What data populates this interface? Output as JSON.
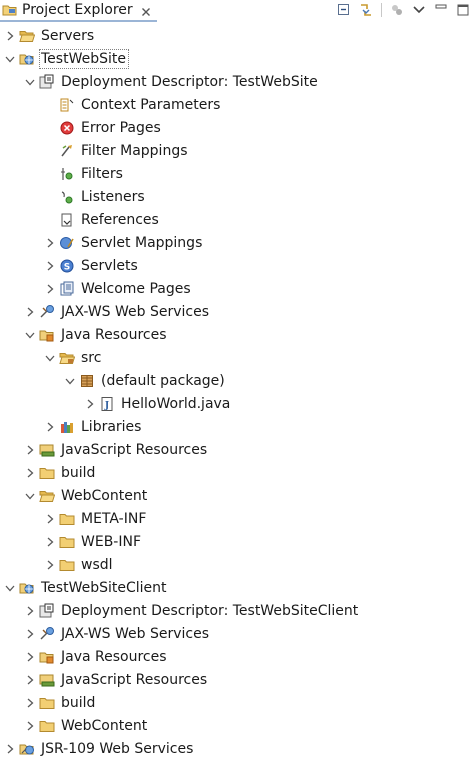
{
  "view": {
    "title": "Project Explorer",
    "close_icon": "close-x-icon",
    "toolbar": [
      {
        "name": "collapse-all-icon"
      },
      {
        "name": "link-with-editor-icon"
      },
      {
        "name": "filter-disabled-icon"
      },
      {
        "name": "view-menu-chevron-icon"
      },
      {
        "name": "minimize-icon"
      },
      {
        "name": "maximize-icon"
      }
    ]
  },
  "tree": [
    {
      "label": "Servers",
      "depth": 0,
      "twisty": "collapsed",
      "icon": "folder-open"
    },
    {
      "label": "TestWebSite",
      "depth": 0,
      "twisty": "expanded",
      "icon": "web-project",
      "selected": true
    },
    {
      "label": "Deployment Descriptor: TestWebSite",
      "depth": 1,
      "twisty": "expanded",
      "icon": "deployment-descriptor"
    },
    {
      "label": "Context Parameters",
      "depth": 2,
      "twisty": "none",
      "icon": "context-params"
    },
    {
      "label": "Error Pages",
      "depth": 2,
      "twisty": "none",
      "icon": "error"
    },
    {
      "label": "Filter Mappings",
      "depth": 2,
      "twisty": "none",
      "icon": "filter-mapping"
    },
    {
      "label": "Filters",
      "depth": 2,
      "twisty": "none",
      "icon": "filter"
    },
    {
      "label": "Listeners",
      "depth": 2,
      "twisty": "none",
      "icon": "listener"
    },
    {
      "label": "References",
      "depth": 2,
      "twisty": "none",
      "icon": "reference"
    },
    {
      "label": "Servlet Mappings",
      "depth": 2,
      "twisty": "collapsed",
      "icon": "servlet-mapping"
    },
    {
      "label": "Servlets",
      "depth": 2,
      "twisty": "collapsed",
      "icon": "servlet"
    },
    {
      "label": "Welcome Pages",
      "depth": 2,
      "twisty": "collapsed",
      "icon": "welcome-pages"
    },
    {
      "label": "JAX-WS Web Services",
      "depth": 1,
      "twisty": "collapsed",
      "icon": "web-services"
    },
    {
      "label": "Java Resources",
      "depth": 1,
      "twisty": "expanded",
      "icon": "java-resources"
    },
    {
      "label": "src",
      "depth": 2,
      "twisty": "expanded",
      "icon": "source-folder"
    },
    {
      "label": "(default package)",
      "depth": 3,
      "twisty": "expanded",
      "icon": "package"
    },
    {
      "label": "HelloWorld.java",
      "depth": 4,
      "twisty": "collapsed",
      "icon": "java-file"
    },
    {
      "label": "Libraries",
      "depth": 2,
      "twisty": "collapsed",
      "icon": "libraries"
    },
    {
      "label": "JavaScript Resources",
      "depth": 1,
      "twisty": "collapsed",
      "icon": "js-resources"
    },
    {
      "label": "build",
      "depth": 1,
      "twisty": "collapsed",
      "icon": "folder"
    },
    {
      "label": "WebContent",
      "depth": 1,
      "twisty": "expanded",
      "icon": "folder-open"
    },
    {
      "label": "META-INF",
      "depth": 2,
      "twisty": "collapsed",
      "icon": "folder"
    },
    {
      "label": "WEB-INF",
      "depth": 2,
      "twisty": "collapsed",
      "icon": "folder"
    },
    {
      "label": "wsdl",
      "depth": 2,
      "twisty": "collapsed",
      "icon": "folder"
    },
    {
      "label": "TestWebSiteClient",
      "depth": 0,
      "twisty": "expanded",
      "icon": "web-project"
    },
    {
      "label": "Deployment Descriptor: TestWebSiteClient",
      "depth": 1,
      "twisty": "collapsed",
      "icon": "deployment-descriptor"
    },
    {
      "label": "JAX-WS Web Services",
      "depth": 1,
      "twisty": "collapsed",
      "icon": "web-services"
    },
    {
      "label": "Java Resources",
      "depth": 1,
      "twisty": "collapsed",
      "icon": "java-resources"
    },
    {
      "label": "JavaScript Resources",
      "depth": 1,
      "twisty": "collapsed",
      "icon": "js-resources"
    },
    {
      "label": "build",
      "depth": 1,
      "twisty": "collapsed",
      "icon": "folder"
    },
    {
      "label": "WebContent",
      "depth": 1,
      "twisty": "collapsed",
      "icon": "folder"
    },
    {
      "label": "JSR-109 Web Services",
      "depth": 0,
      "twisty": "collapsed",
      "icon": "jsr109-services"
    }
  ]
}
